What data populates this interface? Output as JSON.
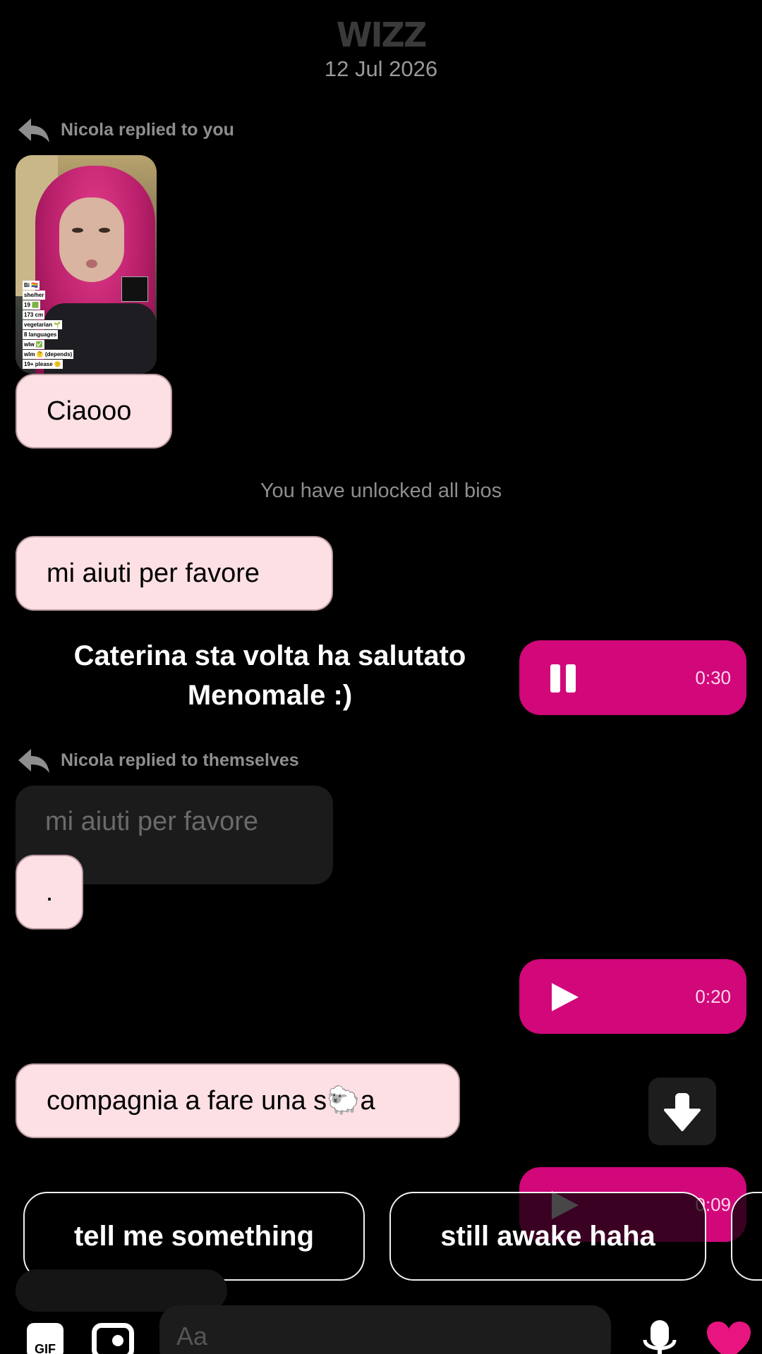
{
  "header": {
    "logo": "WIZZ",
    "date": "12 Jul 2026"
  },
  "messages": {
    "reply_note_1": "Nicola replied to you",
    "photo_bios": [
      "Bi 🏳️‍🌈",
      "she/her",
      "19 🟩",
      "173 cm",
      "vegetarian 🌱",
      "8 languages",
      "wlw ✅",
      "wlm 🤔 (depends)",
      "19+ please 🙂"
    ],
    "ciaooo": "Ciaooo",
    "system_note": "You have unlocked all bios",
    "mi_aiuti": "mi aiuti per favore",
    "caption": "Caterina sta volta ha salutato Menomale :)",
    "voice_1": {
      "state": "playing",
      "duration": "0:30"
    },
    "reply_note_2": "Nicola replied to themselves",
    "quoted": "mi aiuti per favore",
    "dot_reply": ".",
    "voice_2": {
      "state": "paused",
      "duration": "0:20"
    },
    "compagnia": "compagnia a fare una s🐑a",
    "voice_3": {
      "state": "paused",
      "duration": "0:09"
    }
  },
  "suggestions": [
    "tell me something",
    "still awake haha"
  ],
  "composer": {
    "placeholder": "Aa",
    "gif_label": "GIF"
  },
  "colors": {
    "accent": "#d1077a",
    "incoming_bubble": "#fde0e4",
    "background": "#000000"
  },
  "icons": [
    "reply-arrow-icon",
    "pause-icon",
    "play-icon",
    "arrow-down-icon",
    "gif-icon",
    "photo-icon",
    "mic-icon",
    "heart-icon"
  ]
}
